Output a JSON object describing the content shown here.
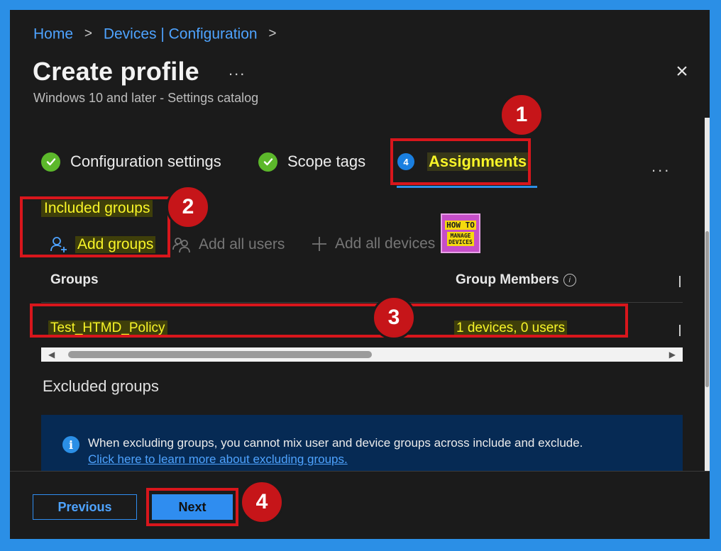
{
  "breadcrumb": {
    "items": [
      "Home",
      "Devices | Configuration"
    ],
    "separator": ">"
  },
  "header": {
    "title": "Create profile",
    "more": "...",
    "close": "×",
    "subtitle": "Windows 10 and later - Settings catalog"
  },
  "tabs": [
    {
      "label": "Configuration settings",
      "state": "completed",
      "icon": "check-circle-icon"
    },
    {
      "label": "Scope tags",
      "state": "completed",
      "icon": "check-circle-icon"
    },
    {
      "label": "Assignments",
      "state": "active",
      "step": "4"
    }
  ],
  "tabs_more": "...",
  "included": {
    "label": "Included groups",
    "actions": {
      "add_groups": "Add groups",
      "add_all_users": "Add all users",
      "add_all_devices": "Add all devices"
    }
  },
  "logo": {
    "line1": "HOW TO",
    "line2": "MANAGE",
    "line3": "DEVICES"
  },
  "table": {
    "columns": [
      "Groups",
      "Group Members"
    ],
    "rows": [
      {
        "group": "Test_HTMD_Policy",
        "members": "1 devices, 0 users"
      }
    ]
  },
  "excluded": {
    "label": "Excluded groups",
    "info_text": "When excluding groups, you cannot mix user and device groups across include and exclude.",
    "info_link": "Click here to learn more about excluding groups."
  },
  "footer": {
    "previous": "Previous",
    "next": "Next"
  },
  "callouts": [
    "1",
    "2",
    "3",
    "4"
  ],
  "colors": {
    "accent": "#2b8fe6",
    "highlight_text": "#f8f528",
    "callout_red": "#d8161c",
    "success": "#5cb82b",
    "info_bg": "#062a54"
  }
}
